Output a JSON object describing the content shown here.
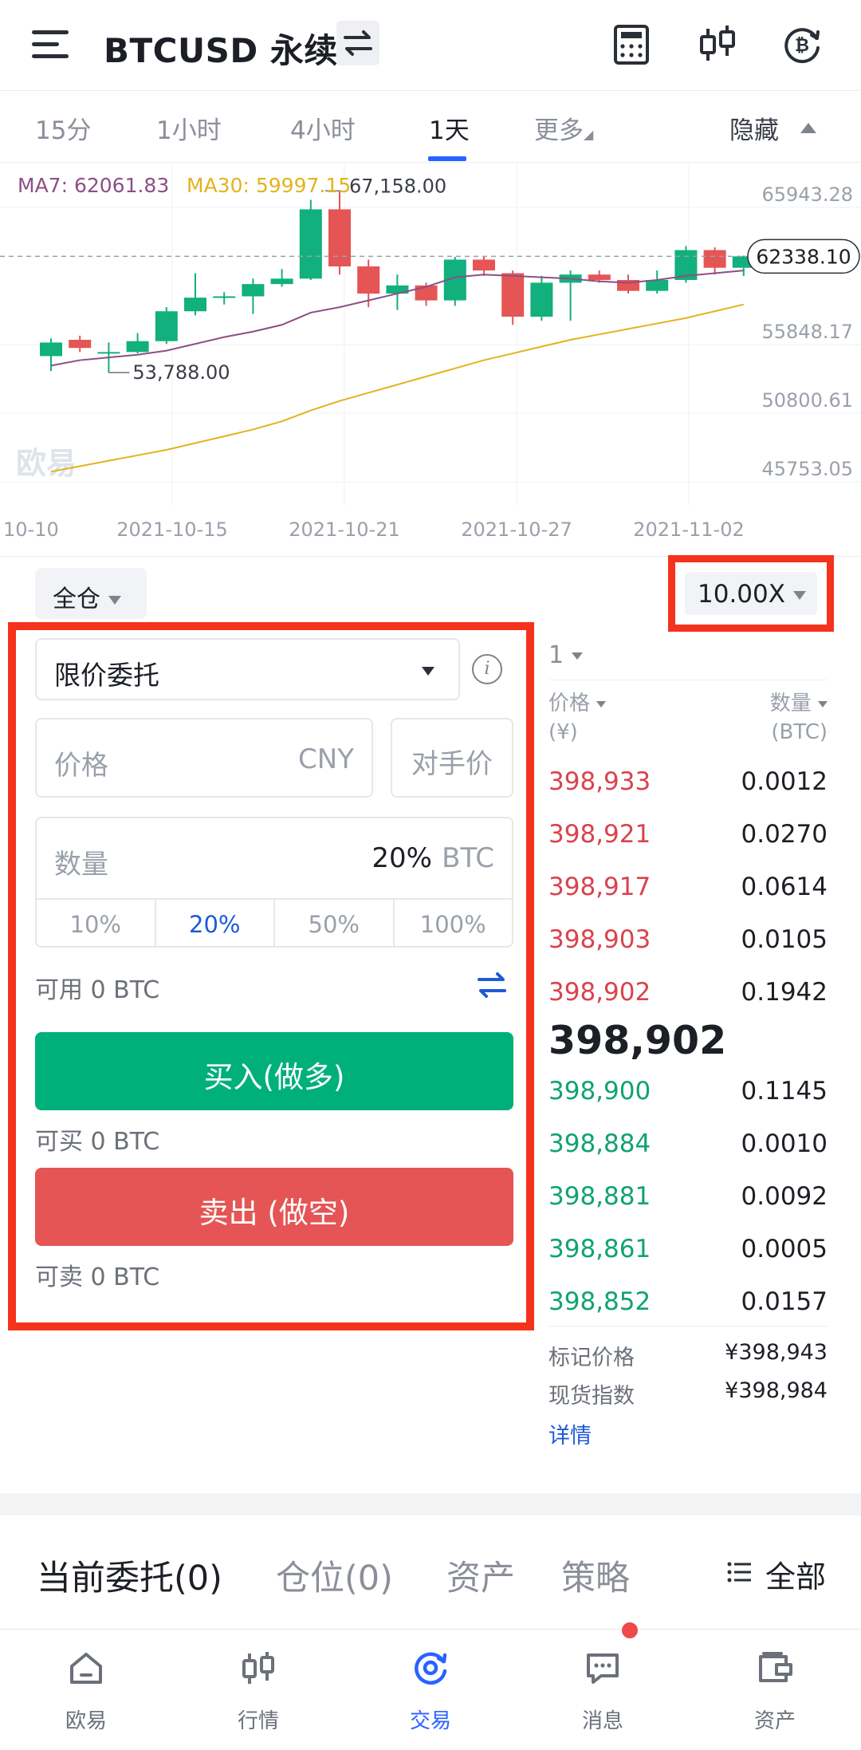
{
  "header": {
    "title": "BTCUSD 永续",
    "icons": [
      "menu-icon",
      "swap-icon",
      "calculator-icon",
      "candlestick-icon",
      "bitcoin-refresh-icon"
    ]
  },
  "timeframes": {
    "tabs": [
      "15分",
      "1小时",
      "4小时",
      "1天",
      "更多"
    ],
    "active": "1天",
    "hide_label": "隐藏"
  },
  "chart_data": {
    "type": "candlestick",
    "ma7_label": "MA7: 62061.83",
    "ma30_label": "MA30: 59997.15",
    "colors": {
      "up": "#11b07c",
      "down": "#e55555",
      "ma7": "#8c4f85",
      "ma30": "#e3b31c"
    },
    "y_ticks": [
      "65943.28",
      "55848.17",
      "50800.61",
      "45753.05"
    ],
    "y_tick_values": [
      65943.28,
      55848.17,
      50800.61,
      45753.05
    ],
    "x_ticks": [
      "10-10",
      "2021-10-15",
      "2021-10-21",
      "2021-10-27",
      "2021-11-02"
    ],
    "current_price": "62338.10",
    "high_label": "67,158.00",
    "low_label": "53,788.00",
    "candles": [
      {
        "o": 55000,
        "h": 56300,
        "l": 53900,
        "c": 56000
      },
      {
        "o": 56200,
        "h": 56500,
        "l": 55300,
        "c": 55600
      },
      {
        "o": 55300,
        "h": 56000,
        "l": 53788,
        "c": 55300
      },
      {
        "o": 55300,
        "h": 56700,
        "l": 55200,
        "c": 56100
      },
      {
        "o": 56100,
        "h": 58600,
        "l": 55900,
        "c": 58300
      },
      {
        "o": 58300,
        "h": 61100,
        "l": 58000,
        "c": 59300
      },
      {
        "o": 59300,
        "h": 59700,
        "l": 58800,
        "c": 59400
      },
      {
        "o": 59400,
        "h": 60700,
        "l": 58100,
        "c": 60300
      },
      {
        "o": 60300,
        "h": 61400,
        "l": 60100,
        "c": 60700
      },
      {
        "o": 60700,
        "h": 66500,
        "l": 60600,
        "c": 65800
      },
      {
        "o": 65800,
        "h": 67158,
        "l": 61000,
        "c": 61600
      },
      {
        "o": 61600,
        "h": 62100,
        "l": 58600,
        "c": 59600
      },
      {
        "o": 59600,
        "h": 61000,
        "l": 58400,
        "c": 60200
      },
      {
        "o": 60200,
        "h": 60400,
        "l": 58700,
        "c": 59100
      },
      {
        "o": 59100,
        "h": 62300,
        "l": 58700,
        "c": 62100
      },
      {
        "o": 62100,
        "h": 62300,
        "l": 60900,
        "c": 61300
      },
      {
        "o": 61100,
        "h": 61300,
        "l": 57300,
        "c": 57900
      },
      {
        "o": 57900,
        "h": 60900,
        "l": 57600,
        "c": 60400
      },
      {
        "o": 60400,
        "h": 61300,
        "l": 57600,
        "c": 61000
      },
      {
        "o": 61000,
        "h": 61300,
        "l": 60400,
        "c": 60600
      },
      {
        "o": 60600,
        "h": 61000,
        "l": 59600,
        "c": 59800
      },
      {
        "o": 59800,
        "h": 61300,
        "l": 59600,
        "c": 60600
      },
      {
        "o": 60600,
        "h": 63100,
        "l": 60400,
        "c": 62800
      },
      {
        "o": 62800,
        "h": 63000,
        "l": 61000,
        "c": 61500
      },
      {
        "o": 61500,
        "h": 62400,
        "l": 60900,
        "c": 62338.1
      }
    ],
    "ma7": [
      54300,
      54700,
      54900,
      55100,
      55400,
      55900,
      56400,
      56800,
      57300,
      58200,
      58600,
      59100,
      59600,
      60100,
      60800,
      61000,
      60900,
      60800,
      60700,
      60500,
      60400,
      60600,
      60900,
      61100,
      61300
    ],
    "ma30": [
      46500,
      46900,
      47300,
      47700,
      48100,
      48600,
      49100,
      49600,
      50200,
      51000,
      51700,
      52300,
      52900,
      53500,
      54100,
      54700,
      55200,
      55700,
      56200,
      56600,
      57000,
      57400,
      57800,
      58300,
      58800
    ]
  },
  "order": {
    "margin_mode": "全仓",
    "leverage": "10.00X",
    "order_type": "限价委托",
    "price_placeholder": "价格",
    "price_unit": "CNY",
    "counterparty_label": "对手价",
    "qty_placeholder": "数量",
    "qty_value": "20%",
    "qty_unit": "BTC",
    "percent_options": [
      "10%",
      "20%",
      "50%",
      "100%"
    ],
    "active_percent": "20%",
    "available": "可用  0 BTC",
    "buy_label": "买入(做多)",
    "can_buy": "可买  0 BTC",
    "sell_label": "卖出 (做空)",
    "can_sell": "可卖  0 BTC"
  },
  "orderbook": {
    "depth": "1",
    "price_header": "价格",
    "price_unit": "(¥)",
    "qty_header": "数量",
    "qty_unit": "(BTC)",
    "asks": [
      {
        "price": "398,933",
        "qty": "0.0012"
      },
      {
        "price": "398,921",
        "qty": "0.0270"
      },
      {
        "price": "398,917",
        "qty": "0.0614"
      },
      {
        "price": "398,903",
        "qty": "0.0105"
      },
      {
        "price": "398,902",
        "qty": "0.1942"
      }
    ],
    "last_price": "398,902",
    "bids": [
      {
        "price": "398,900",
        "qty": "0.1145"
      },
      {
        "price": "398,884",
        "qty": "0.0010"
      },
      {
        "price": "398,881",
        "qty": "0.0092"
      },
      {
        "price": "398,861",
        "qty": "0.0005"
      },
      {
        "price": "398,852",
        "qty": "0.0157"
      }
    ],
    "mark_price_label": "标记价格",
    "mark_price": "¥398,943",
    "index_label": "现货指数",
    "index_price": "¥398,984",
    "detail_link": "详情"
  },
  "positions": {
    "tabs": [
      "当前委托(0)",
      "仓位(0)",
      "资产",
      "策略"
    ],
    "all_label": "全部"
  },
  "nav": {
    "items": [
      "欧易",
      "行情",
      "交易",
      "消息",
      "资产"
    ],
    "active": "交易"
  },
  "watermark": "欧易"
}
